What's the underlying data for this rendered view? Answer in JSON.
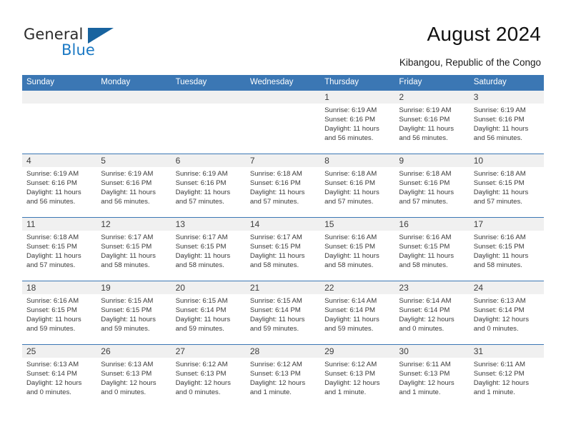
{
  "brand": {
    "name_part1": "General",
    "name_part2": "Blue",
    "flag_icon": "triangle-flag-icon",
    "accent_color": "#1b79c4"
  },
  "header": {
    "title": "August 2024",
    "subtitle": "Kibangou, Republic of the Congo"
  },
  "calendar": {
    "header_bg": "#3b77b4",
    "day_band_bg": "#f0f0f0",
    "weekdays": [
      "Sunday",
      "Monday",
      "Tuesday",
      "Wednesday",
      "Thursday",
      "Friday",
      "Saturday"
    ],
    "weeks": [
      [
        {
          "day": "",
          "empty": true,
          "sunrise": "",
          "sunset": "",
          "daylight_line1": "",
          "daylight_line2": ""
        },
        {
          "day": "",
          "empty": true,
          "sunrise": "",
          "sunset": "",
          "daylight_line1": "",
          "daylight_line2": ""
        },
        {
          "day": "",
          "empty": true,
          "sunrise": "",
          "sunset": "",
          "daylight_line1": "",
          "daylight_line2": ""
        },
        {
          "day": "",
          "empty": true,
          "sunrise": "",
          "sunset": "",
          "daylight_line1": "",
          "daylight_line2": ""
        },
        {
          "day": "1",
          "empty": false,
          "sunrise": "Sunrise: 6:19 AM",
          "sunset": "Sunset: 6:16 PM",
          "daylight_line1": "Daylight: 11 hours",
          "daylight_line2": "and 56 minutes."
        },
        {
          "day": "2",
          "empty": false,
          "sunrise": "Sunrise: 6:19 AM",
          "sunset": "Sunset: 6:16 PM",
          "daylight_line1": "Daylight: 11 hours",
          "daylight_line2": "and 56 minutes."
        },
        {
          "day": "3",
          "empty": false,
          "sunrise": "Sunrise: 6:19 AM",
          "sunset": "Sunset: 6:16 PM",
          "daylight_line1": "Daylight: 11 hours",
          "daylight_line2": "and 56 minutes."
        }
      ],
      [
        {
          "day": "4",
          "empty": false,
          "sunrise": "Sunrise: 6:19 AM",
          "sunset": "Sunset: 6:16 PM",
          "daylight_line1": "Daylight: 11 hours",
          "daylight_line2": "and 56 minutes."
        },
        {
          "day": "5",
          "empty": false,
          "sunrise": "Sunrise: 6:19 AM",
          "sunset": "Sunset: 6:16 PM",
          "daylight_line1": "Daylight: 11 hours",
          "daylight_line2": "and 56 minutes."
        },
        {
          "day": "6",
          "empty": false,
          "sunrise": "Sunrise: 6:19 AM",
          "sunset": "Sunset: 6:16 PM",
          "daylight_line1": "Daylight: 11 hours",
          "daylight_line2": "and 57 minutes."
        },
        {
          "day": "7",
          "empty": false,
          "sunrise": "Sunrise: 6:18 AM",
          "sunset": "Sunset: 6:16 PM",
          "daylight_line1": "Daylight: 11 hours",
          "daylight_line2": "and 57 minutes."
        },
        {
          "day": "8",
          "empty": false,
          "sunrise": "Sunrise: 6:18 AM",
          "sunset": "Sunset: 6:16 PM",
          "daylight_line1": "Daylight: 11 hours",
          "daylight_line2": "and 57 minutes."
        },
        {
          "day": "9",
          "empty": false,
          "sunrise": "Sunrise: 6:18 AM",
          "sunset": "Sunset: 6:16 PM",
          "daylight_line1": "Daylight: 11 hours",
          "daylight_line2": "and 57 minutes."
        },
        {
          "day": "10",
          "empty": false,
          "sunrise": "Sunrise: 6:18 AM",
          "sunset": "Sunset: 6:15 PM",
          "daylight_line1": "Daylight: 11 hours",
          "daylight_line2": "and 57 minutes."
        }
      ],
      [
        {
          "day": "11",
          "empty": false,
          "sunrise": "Sunrise: 6:18 AM",
          "sunset": "Sunset: 6:15 PM",
          "daylight_line1": "Daylight: 11 hours",
          "daylight_line2": "and 57 minutes."
        },
        {
          "day": "12",
          "empty": false,
          "sunrise": "Sunrise: 6:17 AM",
          "sunset": "Sunset: 6:15 PM",
          "daylight_line1": "Daylight: 11 hours",
          "daylight_line2": "and 58 minutes."
        },
        {
          "day": "13",
          "empty": false,
          "sunrise": "Sunrise: 6:17 AM",
          "sunset": "Sunset: 6:15 PM",
          "daylight_line1": "Daylight: 11 hours",
          "daylight_line2": "and 58 minutes."
        },
        {
          "day": "14",
          "empty": false,
          "sunrise": "Sunrise: 6:17 AM",
          "sunset": "Sunset: 6:15 PM",
          "daylight_line1": "Daylight: 11 hours",
          "daylight_line2": "and 58 minutes."
        },
        {
          "day": "15",
          "empty": false,
          "sunrise": "Sunrise: 6:16 AM",
          "sunset": "Sunset: 6:15 PM",
          "daylight_line1": "Daylight: 11 hours",
          "daylight_line2": "and 58 minutes."
        },
        {
          "day": "16",
          "empty": false,
          "sunrise": "Sunrise: 6:16 AM",
          "sunset": "Sunset: 6:15 PM",
          "daylight_line1": "Daylight: 11 hours",
          "daylight_line2": "and 58 minutes."
        },
        {
          "day": "17",
          "empty": false,
          "sunrise": "Sunrise: 6:16 AM",
          "sunset": "Sunset: 6:15 PM",
          "daylight_line1": "Daylight: 11 hours",
          "daylight_line2": "and 58 minutes."
        }
      ],
      [
        {
          "day": "18",
          "empty": false,
          "sunrise": "Sunrise: 6:16 AM",
          "sunset": "Sunset: 6:15 PM",
          "daylight_line1": "Daylight: 11 hours",
          "daylight_line2": "and 59 minutes."
        },
        {
          "day": "19",
          "empty": false,
          "sunrise": "Sunrise: 6:15 AM",
          "sunset": "Sunset: 6:15 PM",
          "daylight_line1": "Daylight: 11 hours",
          "daylight_line2": "and 59 minutes."
        },
        {
          "day": "20",
          "empty": false,
          "sunrise": "Sunrise: 6:15 AM",
          "sunset": "Sunset: 6:14 PM",
          "daylight_line1": "Daylight: 11 hours",
          "daylight_line2": "and 59 minutes."
        },
        {
          "day": "21",
          "empty": false,
          "sunrise": "Sunrise: 6:15 AM",
          "sunset": "Sunset: 6:14 PM",
          "daylight_line1": "Daylight: 11 hours",
          "daylight_line2": "and 59 minutes."
        },
        {
          "day": "22",
          "empty": false,
          "sunrise": "Sunrise: 6:14 AM",
          "sunset": "Sunset: 6:14 PM",
          "daylight_line1": "Daylight: 11 hours",
          "daylight_line2": "and 59 minutes."
        },
        {
          "day": "23",
          "empty": false,
          "sunrise": "Sunrise: 6:14 AM",
          "sunset": "Sunset: 6:14 PM",
          "daylight_line1": "Daylight: 12 hours",
          "daylight_line2": "and 0 minutes."
        },
        {
          "day": "24",
          "empty": false,
          "sunrise": "Sunrise: 6:13 AM",
          "sunset": "Sunset: 6:14 PM",
          "daylight_line1": "Daylight: 12 hours",
          "daylight_line2": "and 0 minutes."
        }
      ],
      [
        {
          "day": "25",
          "empty": false,
          "sunrise": "Sunrise: 6:13 AM",
          "sunset": "Sunset: 6:14 PM",
          "daylight_line1": "Daylight: 12 hours",
          "daylight_line2": "and 0 minutes."
        },
        {
          "day": "26",
          "empty": false,
          "sunrise": "Sunrise: 6:13 AM",
          "sunset": "Sunset: 6:13 PM",
          "daylight_line1": "Daylight: 12 hours",
          "daylight_line2": "and 0 minutes."
        },
        {
          "day": "27",
          "empty": false,
          "sunrise": "Sunrise: 6:12 AM",
          "sunset": "Sunset: 6:13 PM",
          "daylight_line1": "Daylight: 12 hours",
          "daylight_line2": "and 0 minutes."
        },
        {
          "day": "28",
          "empty": false,
          "sunrise": "Sunrise: 6:12 AM",
          "sunset": "Sunset: 6:13 PM",
          "daylight_line1": "Daylight: 12 hours",
          "daylight_line2": "and 1 minute."
        },
        {
          "day": "29",
          "empty": false,
          "sunrise": "Sunrise: 6:12 AM",
          "sunset": "Sunset: 6:13 PM",
          "daylight_line1": "Daylight: 12 hours",
          "daylight_line2": "and 1 minute."
        },
        {
          "day": "30",
          "empty": false,
          "sunrise": "Sunrise: 6:11 AM",
          "sunset": "Sunset: 6:13 PM",
          "daylight_line1": "Daylight: 12 hours",
          "daylight_line2": "and 1 minute."
        },
        {
          "day": "31",
          "empty": false,
          "sunrise": "Sunrise: 6:11 AM",
          "sunset": "Sunset: 6:12 PM",
          "daylight_line1": "Daylight: 12 hours",
          "daylight_line2": "and 1 minute."
        }
      ]
    ]
  }
}
